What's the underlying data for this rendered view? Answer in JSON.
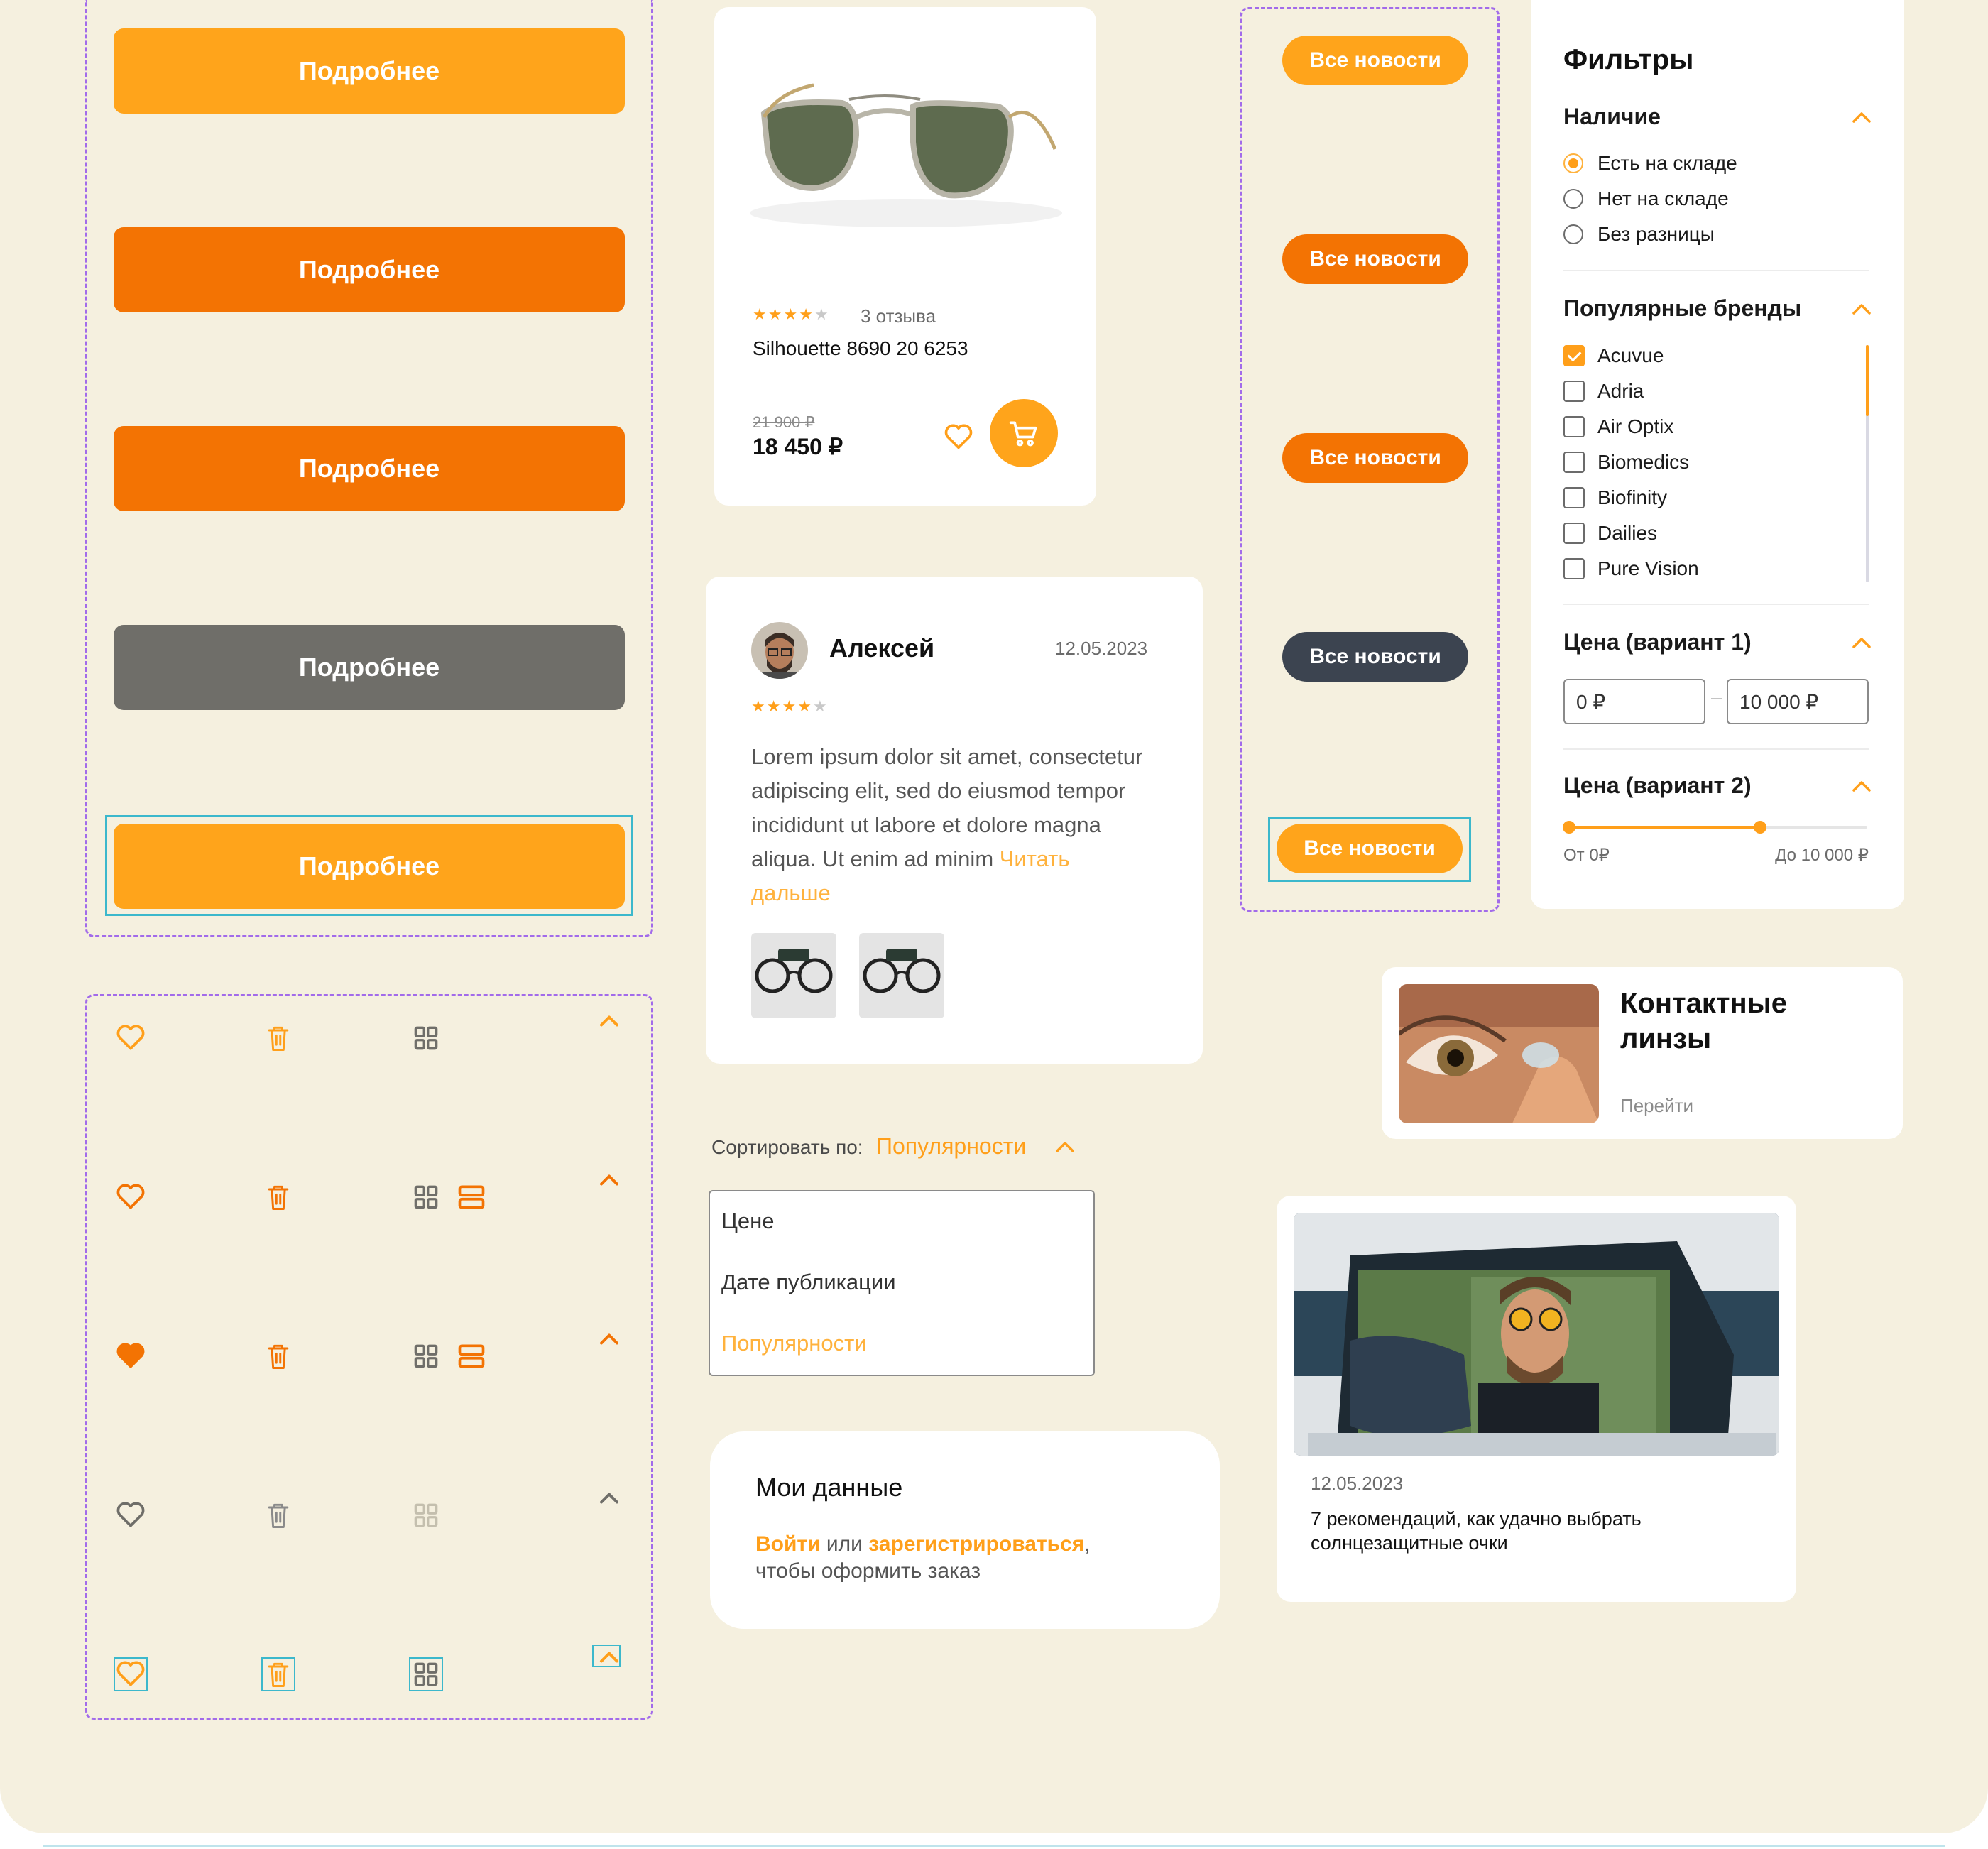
{
  "colors": {
    "background": "#f5f0df",
    "accent": "#ff9f1a",
    "accent_dark": "#f37303",
    "gray_button": "#6f6e69",
    "dark_button": "#3c4450",
    "selection": "#3cb8cc",
    "guide": "#a26bea"
  },
  "more_buttons": {
    "labels": [
      "Подробнее",
      "Подробнее",
      "Подробнее",
      "Подробнее",
      "Подробнее"
    ],
    "states": [
      "default",
      "hover",
      "active",
      "disabled",
      "focus"
    ]
  },
  "icons": {
    "names": [
      "heart-icon",
      "trash-icon",
      "grid-view-icon",
      "list-view-icon",
      "chevron-up-icon"
    ],
    "states": [
      "default",
      "hover",
      "active",
      "disabled",
      "focus"
    ]
  },
  "product": {
    "review_count": "3 отзыва",
    "rating": 4,
    "name": "Silhouette 8690 20 6253",
    "old_price": "21 900 ₽",
    "price": "18 450 ₽"
  },
  "review": {
    "author": "Алексей",
    "date": "12.05.2023",
    "rating": 4,
    "text": "Lorem ipsum dolor sit amet, consectetur adipiscing elit, sed do eiusmod tempor incididunt ut labore et dolore magna aliqua. Ut enim ad minim",
    "read_more": "Читать дальше"
  },
  "sort": {
    "label": "Сортировать по:",
    "selected": "Популярности",
    "options": [
      "Цене",
      "Дате публикации",
      "Популярности"
    ]
  },
  "my_data": {
    "title": "Мои данные",
    "login": "Войти",
    "or": " или ",
    "register": "зарегистрироваться",
    "comma": ",",
    "suffix": "чтобы оформить заказ"
  },
  "news_buttons": {
    "labels": [
      "Все новости",
      "Все новости",
      "Все новости",
      "Все новости",
      "Все новости"
    ],
    "states": [
      "default",
      "hover",
      "active",
      "disabled",
      "focus"
    ]
  },
  "filters": {
    "title": "Фильтры",
    "availability": {
      "title": "Наличие",
      "options": [
        "Есть на складе",
        "Нет на складе",
        "Без разницы"
      ],
      "selected": 0
    },
    "brands": {
      "title": "Популярные бренды",
      "options": [
        "Acuvue",
        "Adria",
        "Air Optix",
        "Biomedics",
        "Biofinity",
        "Dailies",
        "Pure Vision"
      ],
      "checked": [
        0
      ]
    },
    "price1": {
      "title": "Цена (вариант 1)",
      "from": "0 ₽",
      "dash": "–",
      "to": "10 000 ₽"
    },
    "price2": {
      "title": "Цена (вариант 2)",
      "from_label": "От 0₽",
      "to_label": "До 10 000 ₽",
      "range_fraction": [
        0,
        0.64
      ]
    }
  },
  "category": {
    "title": "Контактные линзы",
    "link": "Перейти"
  },
  "article": {
    "date": "12.05.2023",
    "title": "7 рекомендаций, как удачно выбрать солнцезащитные очки"
  }
}
